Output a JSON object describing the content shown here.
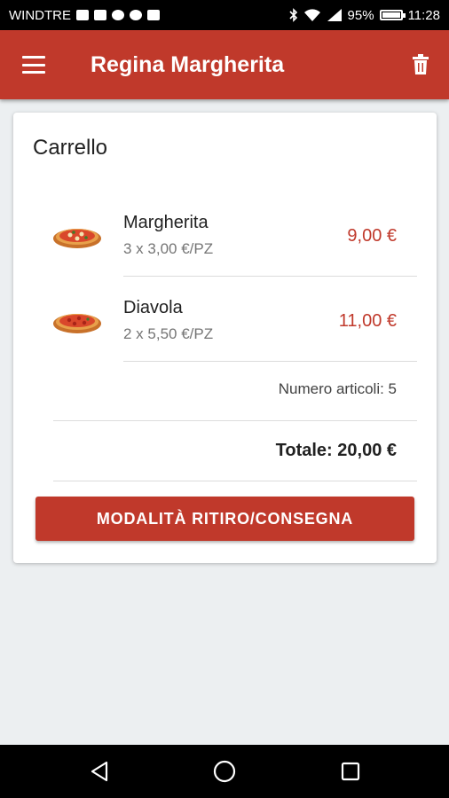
{
  "status_bar": {
    "carrier": "WINDTRE",
    "battery": "95%",
    "battery_level": 0.95,
    "time": "11:28"
  },
  "app_bar": {
    "title": "Regina Margherita",
    "menu_icon": "hamburger-menu-icon",
    "trash_icon": "trash-icon",
    "color": "#c0392b"
  },
  "cart": {
    "title": "Carrello",
    "items": [
      {
        "name": "Margherita",
        "qty": "3 x 3,00 €/PZ",
        "price": "9,00 €",
        "image": "pizza-icon"
      },
      {
        "name": "Diavola",
        "qty": "2 x 5,50 €/PZ",
        "price": "11,00 €",
        "image": "pizza-icon"
      }
    ],
    "item_count": "Numero articoli: 5",
    "total": "Totale: 20,00 €",
    "button_label": "MODALITÀ RITIRO/CONSEGNA",
    "accent_color": "#c0392b"
  },
  "nav_bar": {
    "back_icon": "back-triangle-icon",
    "home_icon": "home-circle-icon",
    "recents_icon": "recents-square-icon"
  }
}
